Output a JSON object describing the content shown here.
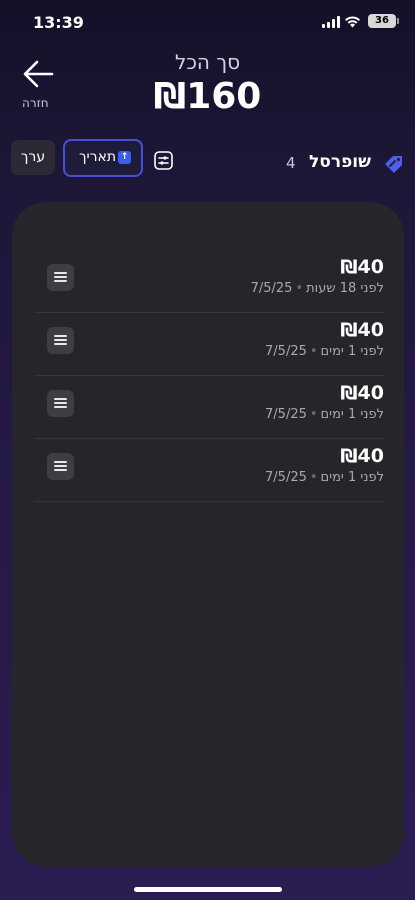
{
  "status_bar": {
    "time": "13:39",
    "battery": "36"
  },
  "header": {
    "back_label": "חזרה",
    "total_label": "סך הכל",
    "total_value": "₪160"
  },
  "toolbar": {
    "edit_label": "ערך",
    "sort_label": "תאריך",
    "store_name": "שופרסל",
    "store_count": "4"
  },
  "items": [
    {
      "amount": "₪40",
      "date": "7/5/25",
      "relative": "לפני 18 שעות"
    },
    {
      "amount": "₪40",
      "date": "7/5/25",
      "relative": "לפני 1 ימים"
    },
    {
      "amount": "₪40",
      "date": "7/5/25",
      "relative": "לפני 1 ימים"
    },
    {
      "amount": "₪40",
      "date": "7/5/25",
      "relative": "לפני 1 ימים"
    }
  ],
  "colors": {
    "accent": "#3f5cf2",
    "card": "#252629",
    "background": "#251a48"
  },
  "icons": [
    "back-arrow-icon",
    "filter-icon",
    "tag-icon",
    "menu-icon",
    "sort-up-icon"
  ]
}
